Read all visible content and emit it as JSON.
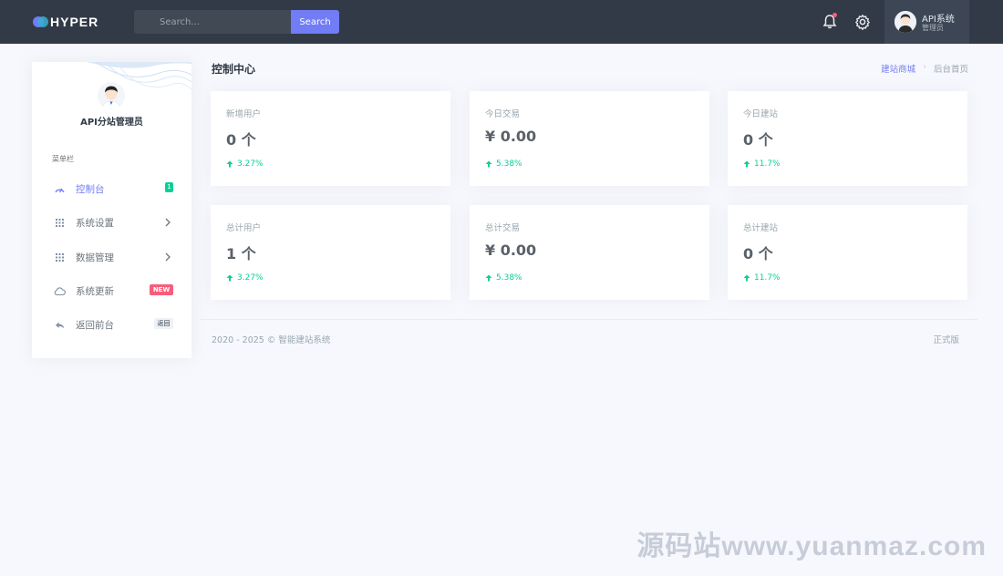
{
  "topbar": {
    "logo_text": "HYPER",
    "search_placeholder": "Search...",
    "search_button": "Search",
    "user_name": "API系统",
    "user_role": "管理员"
  },
  "sidebar": {
    "profile_name": "API分站管理员",
    "menu_title": "菜单栏",
    "items": [
      {
        "label": "控制台",
        "icon": "dashboard-icon",
        "badge": "1"
      },
      {
        "label": "系统设置",
        "icon": "grid-icon"
      },
      {
        "label": "数据管理",
        "icon": "grid-icon"
      },
      {
        "label": "系统更新",
        "icon": "cloud-icon",
        "badge": "NEW"
      },
      {
        "label": "返回前台",
        "icon": "reply-icon",
        "badge": "返回"
      }
    ]
  },
  "main": {
    "title": "控制中心",
    "breadcrumb": [
      "建站商城",
      "后台首页"
    ],
    "cards": [
      {
        "label": "新增用户",
        "value": "0 个",
        "trend": "3.27%"
      },
      {
        "label": "今日交易",
        "value": "¥ 0.00",
        "trend": "5.38%"
      },
      {
        "label": "今日建站",
        "value": "0 个",
        "trend": "11.7%"
      },
      {
        "label": "总计用户",
        "value": "1 个",
        "trend": "3.27%"
      },
      {
        "label": "总计交易",
        "value": "¥ 0.00",
        "trend": "5.38%"
      },
      {
        "label": "总计建站",
        "value": "0 个",
        "trend": "11.7%"
      }
    ]
  },
  "footer": {
    "copyright": "2020 - 2025 © 智能建站系统",
    "version": "正式版"
  },
  "watermark": "源码站www.yuanmaz.com",
  "colors": {
    "topbar": "#313a46",
    "primary": "#727cf5",
    "success": "#0acf97",
    "danger": "#fa5c7c",
    "background": "#f7f8fd"
  }
}
